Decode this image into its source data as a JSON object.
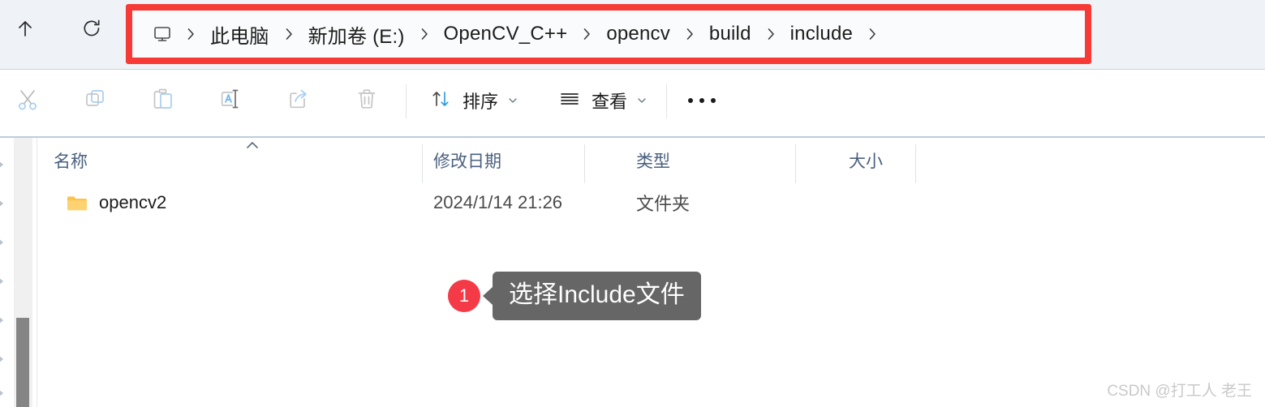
{
  "nav": {
    "up_button": {
      "name": "上移到上一级",
      "icon": "arrow-up-icon"
    },
    "refresh_button": {
      "name": "刷新",
      "icon": "refresh-icon"
    }
  },
  "address_bar": {
    "leading_icon": "monitor-icon",
    "separator": "›",
    "crumbs": [
      {
        "label": "此电脑"
      },
      {
        "label": "新加卷 (E:)"
      },
      {
        "label": "OpenCV_C++"
      },
      {
        "label": "opencv"
      },
      {
        "label": "build"
      },
      {
        "label": "include"
      }
    ]
  },
  "highlight": {
    "color": "#f73a35"
  },
  "toolbar": {
    "icon_buttons": [
      {
        "name": "cut",
        "icon": "scissors-icon",
        "enabled": false
      },
      {
        "name": "copy",
        "icon": "copy-icon",
        "enabled": false
      },
      {
        "name": "paste",
        "icon": "clipboard-icon",
        "enabled": false
      },
      {
        "name": "rename",
        "icon": "rename-icon",
        "enabled": false
      },
      {
        "name": "share",
        "icon": "share-icon",
        "enabled": false
      },
      {
        "name": "delete",
        "icon": "trash-icon",
        "enabled": false
      }
    ],
    "sort": {
      "label": "排序",
      "icon": "sort-arrows-icon",
      "chevron": "chevron-down-icon"
    },
    "view": {
      "label": "查看",
      "icon": "list-lines-icon",
      "chevron": "chevron-down-icon"
    },
    "more": {
      "label": "•••",
      "name": "see-more"
    }
  },
  "file_list": {
    "columns": [
      {
        "label": "名称",
        "sorted": "asc",
        "sort_glyph": "chevron-up-icon"
      },
      {
        "label": "修改日期"
      },
      {
        "label": "类型"
      },
      {
        "label": "大小"
      }
    ],
    "rows": [
      {
        "icon": "folder-icon",
        "name": "opencv2",
        "date_modified": "2024/1/14 21:26",
        "type": "文件夹",
        "size": ""
      }
    ]
  },
  "annotation": {
    "badge_number": "1",
    "text": "选择Include文件",
    "badge_color": "#f43a46",
    "bubble_color": "#666666"
  },
  "watermark": {
    "text": "CSDN @打工人 老王"
  }
}
